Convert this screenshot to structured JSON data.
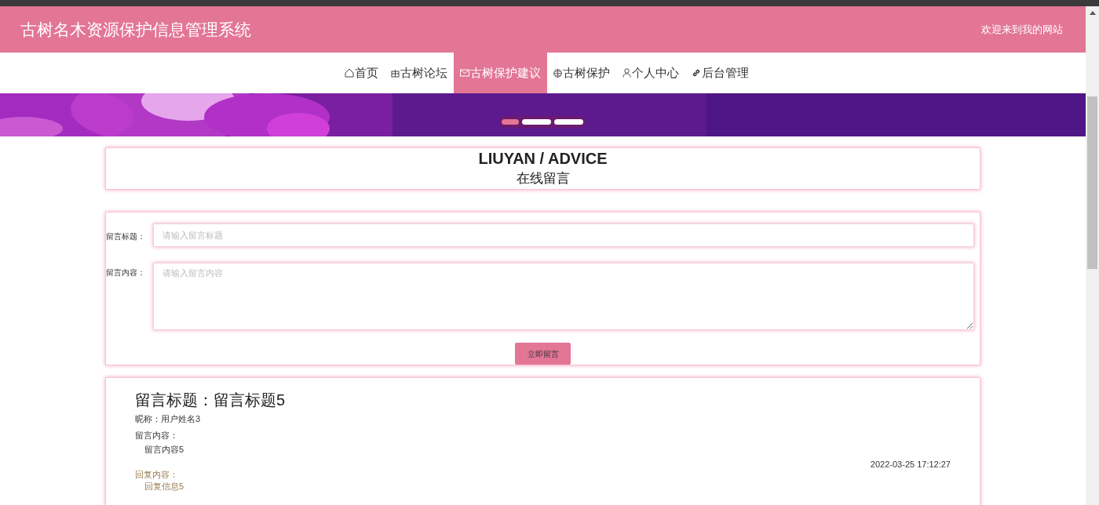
{
  "header": {
    "title": "古树名木资源保护信息管理系统",
    "welcome": "欢迎来到我的网站"
  },
  "nav": [
    {
      "label": "首页",
      "kind": "home",
      "selected": false
    },
    {
      "label": "古树论坛",
      "kind": "grid",
      "selected": false
    },
    {
      "label": "古树保护建议",
      "kind": "mail",
      "selected": true
    },
    {
      "label": "古树保护",
      "kind": "globe",
      "selected": false
    },
    {
      "label": "个人中心",
      "kind": "user",
      "selected": false
    },
    {
      "label": "后台管理",
      "kind": "link",
      "selected": false
    }
  ],
  "banner": {
    "dots": [
      {
        "selected": true
      },
      {
        "selected": false
      },
      {
        "selected": false
      }
    ]
  },
  "section_title": {
    "english": "LIUYAN / ADVICE",
    "chinese": "在线留言"
  },
  "form": {
    "title_label": "留言标题：",
    "title_placeholder": "请输入留言标题",
    "content_label": "留言内容：",
    "content_placeholder": "请输入留言内容",
    "submit": "立即留言"
  },
  "messages": [
    {
      "title": "留言标题：留言标题5",
      "nickname": "昵称：用户姓名3",
      "content_label": "留言内容：",
      "content": "留言内容5",
      "time": "2022-03-25 17:12:27",
      "reply_label": "回复内容：",
      "reply": "回复信息5"
    }
  ]
}
